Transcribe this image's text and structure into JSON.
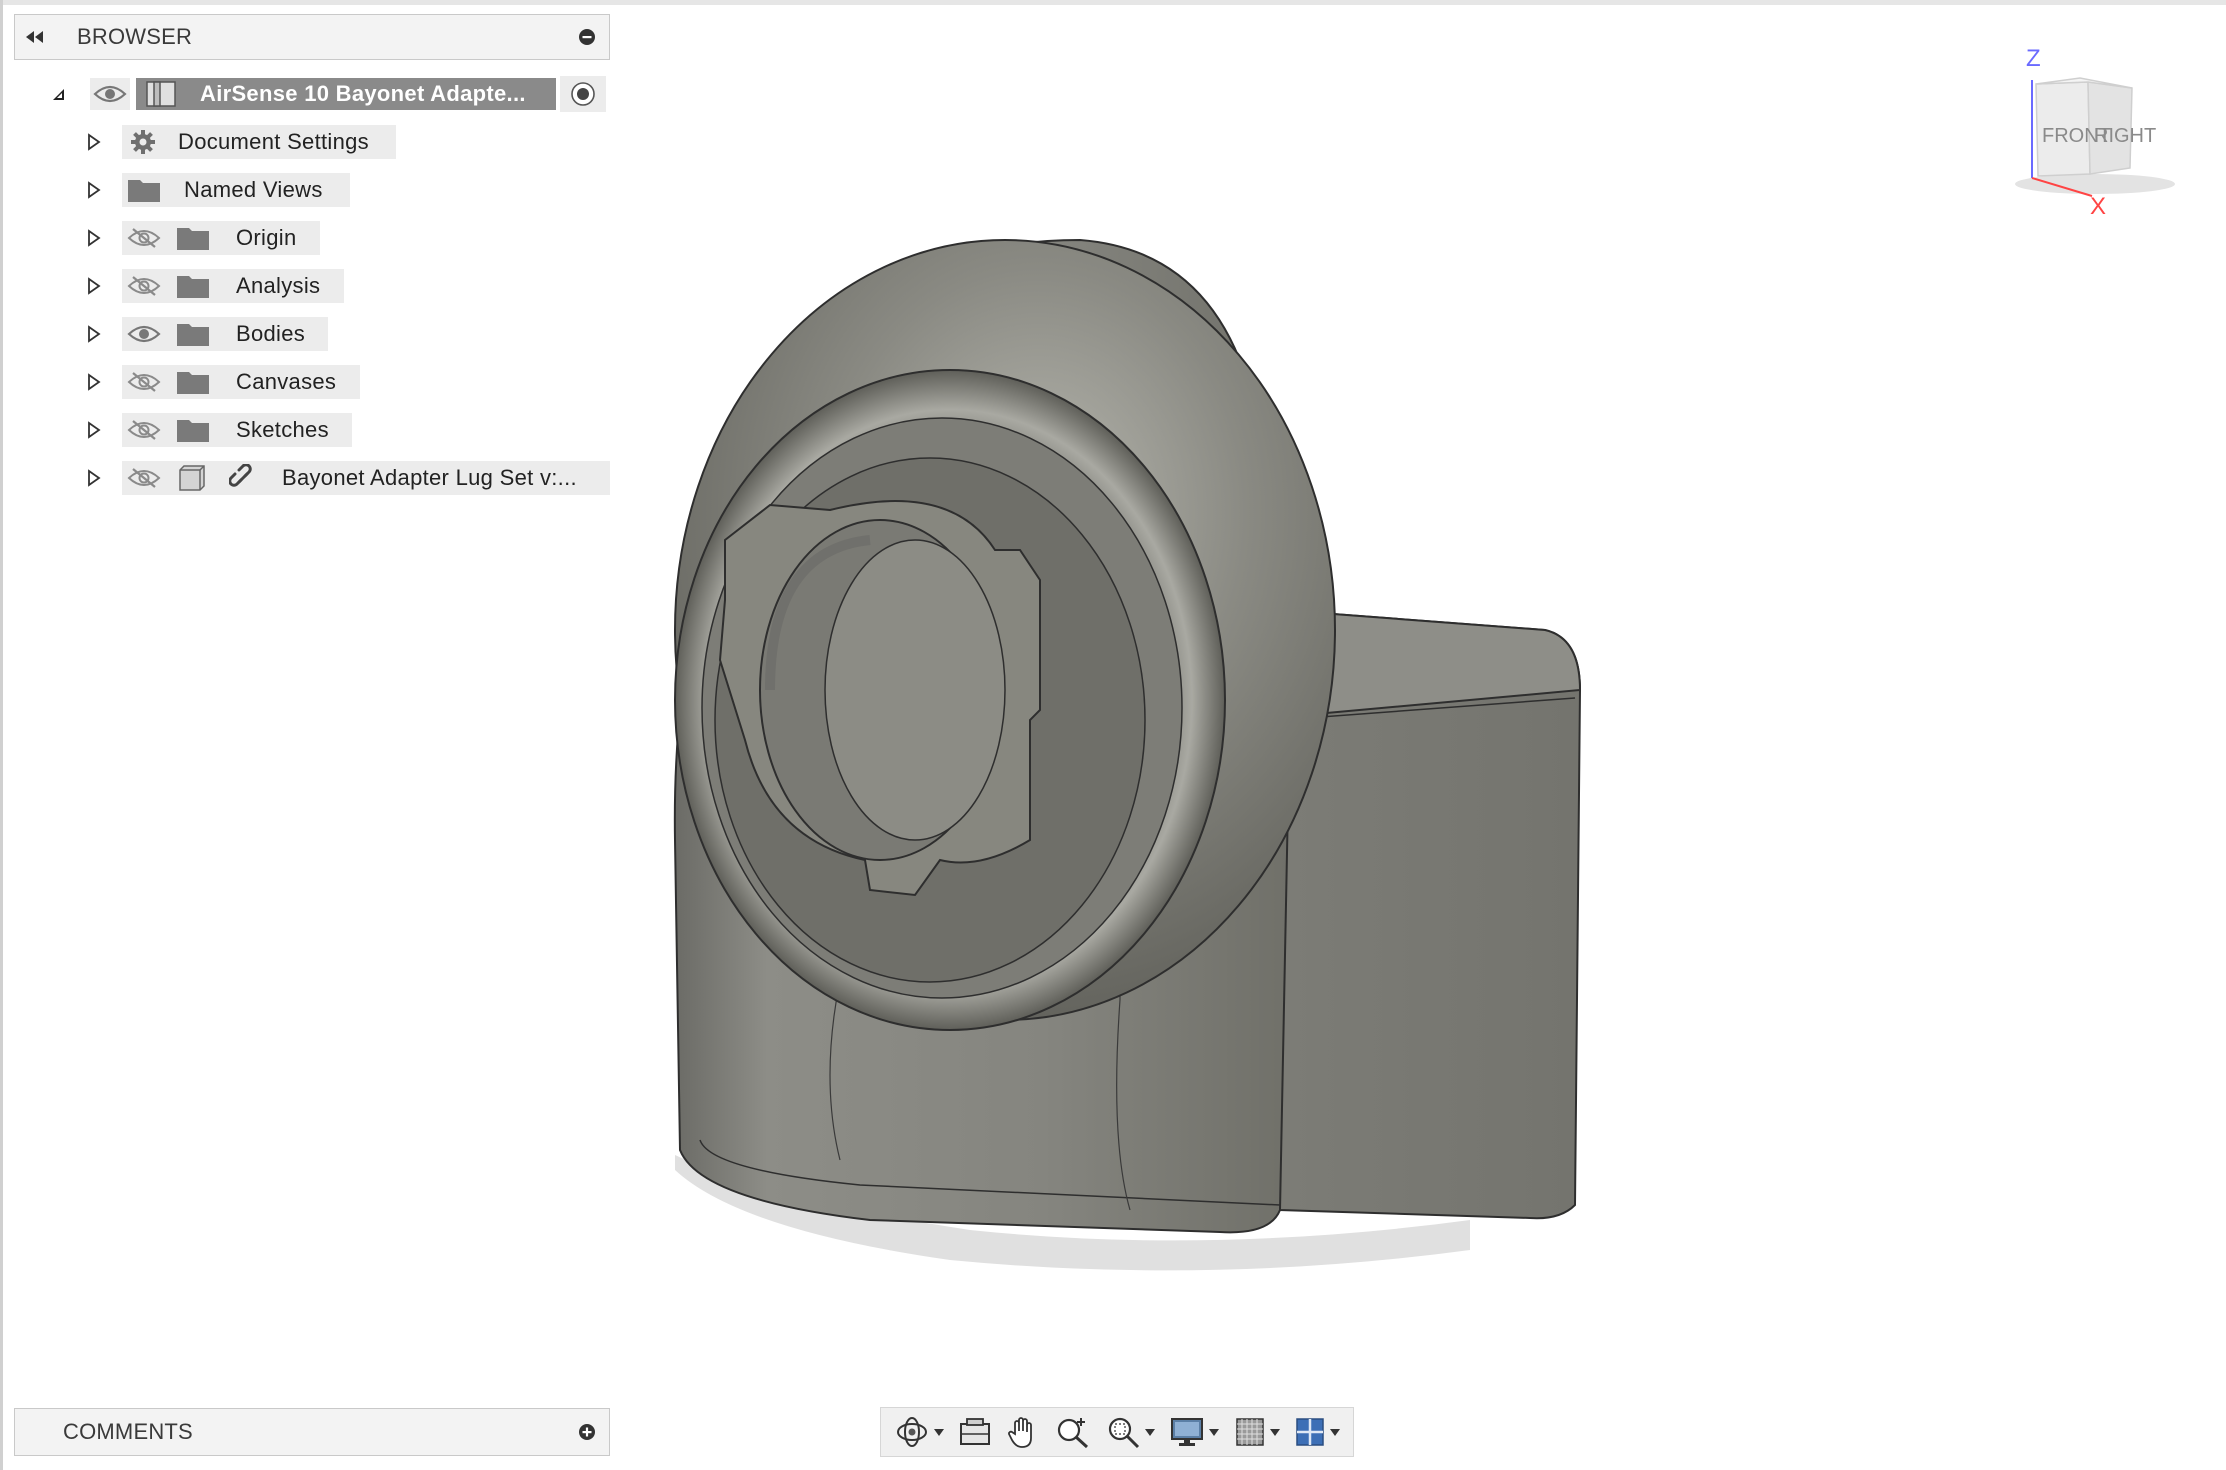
{
  "browser": {
    "title": "BROWSER",
    "root": {
      "label": "AirSense 10 Bayonet Adapte..."
    },
    "items": [
      {
        "label": "Document Settings",
        "icon": "gear-icon"
      },
      {
        "label": "Named Views",
        "icon": "folder-icon"
      },
      {
        "label": "Origin",
        "icon": "folder-icon",
        "visibility": "hidden"
      },
      {
        "label": "Analysis",
        "icon": "folder-icon",
        "visibility": "hidden"
      },
      {
        "label": "Bodies",
        "icon": "folder-icon",
        "visibility": "visible"
      },
      {
        "label": "Canvases",
        "icon": "folder-icon",
        "visibility": "hidden"
      },
      {
        "label": "Sketches",
        "icon": "folder-icon",
        "visibility": "hidden"
      },
      {
        "label": "Bayonet Adapter Lug Set v:...",
        "icon": "component-icon",
        "visibility": "hidden",
        "linked": true
      }
    ]
  },
  "comments": {
    "title": "COMMENTS"
  },
  "viewcube": {
    "z": "Z",
    "x": "X",
    "front": "FRONT",
    "right": "RIGHT"
  },
  "toolbar": {
    "tools": [
      "orbit-icon",
      "look-at-icon",
      "pan-icon",
      "zoom-icon",
      "zoom-window-icon",
      "display-settings-icon",
      "grid-icon",
      "viewports-icon"
    ]
  },
  "colors": {
    "model": "#8a8a84",
    "selection": "#8a8a8a",
    "axis_z": "#6a6aff",
    "axis_x": "#ff4444"
  }
}
